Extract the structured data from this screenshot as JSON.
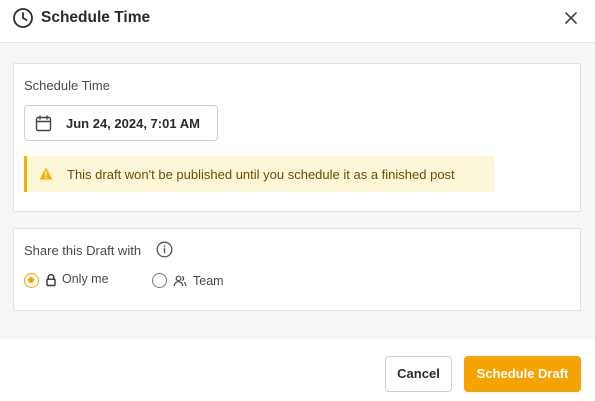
{
  "dialog": {
    "title": "Schedule Time",
    "icons": {
      "header": "clock-icon",
      "close": "close-icon"
    }
  },
  "schedule": {
    "label": "Schedule Time",
    "date_value": "Jun 24, 2024, 7:01 AM",
    "date_icon": "calendar-icon",
    "warning": {
      "text": "This draft won't be published until you schedule it as a finished post",
      "icon": "warning-icon"
    }
  },
  "share": {
    "label": "Share this Draft with",
    "info_icon": "info-icon",
    "options": [
      {
        "label": "Only me",
        "icon": "lock-icon",
        "selected": true
      },
      {
        "label": "Team",
        "icon": "users-icon",
        "selected": false
      }
    ]
  },
  "footer": {
    "cancel_label": "Cancel",
    "primary_label": "Schedule Draft"
  },
  "colors": {
    "accent": "#f5a300",
    "warning_bg": "#fdf7d9",
    "warning_border": "#f5b400",
    "body_bg": "#f6f6f6"
  }
}
